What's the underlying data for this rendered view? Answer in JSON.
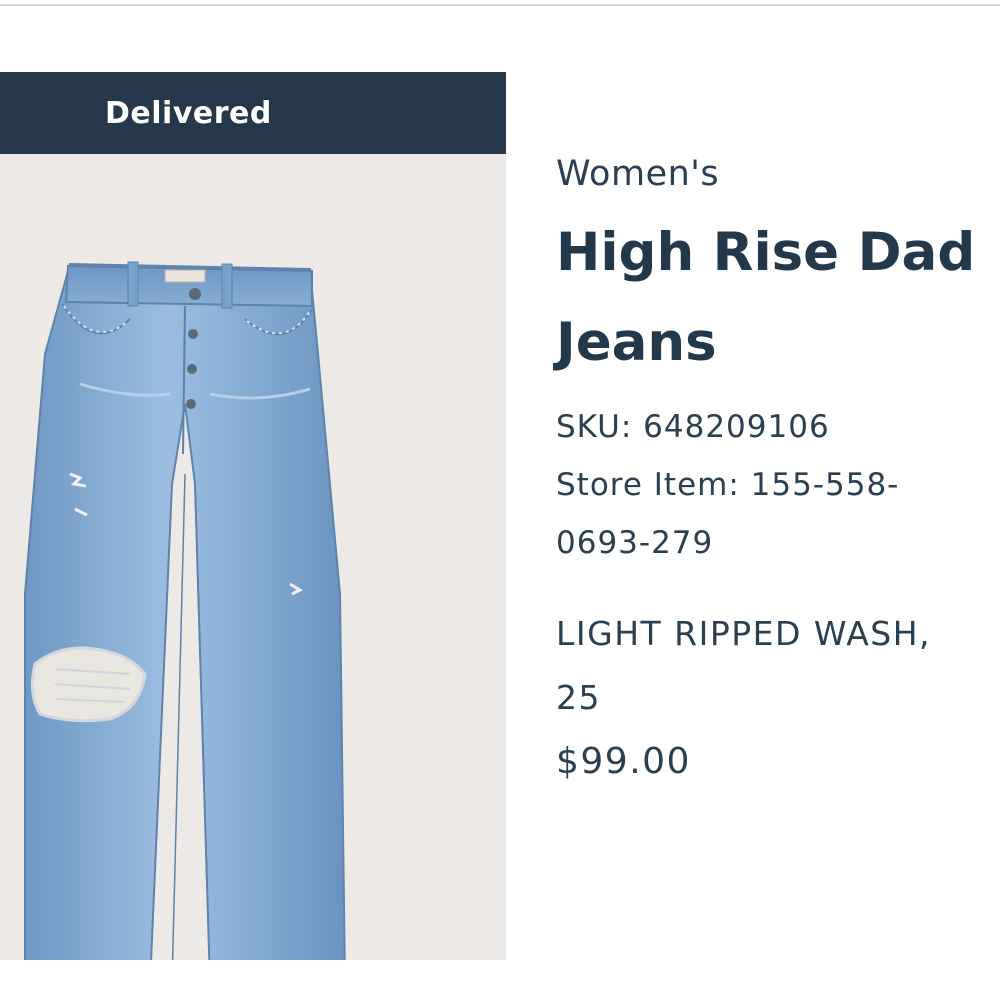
{
  "order_item": {
    "status": "Delivered",
    "image": "light ripped wash high rise dad jeans product photo",
    "category": "Women's",
    "name_line1": "High Rise Dad",
    "name_line2": "Jeans",
    "sku": "SKU: 648209106",
    "store_item_line1": "Store Item: 155-558-",
    "store_item_line2": "0693-279",
    "variant_line1": "LIGHT RIPPED WASH,",
    "variant_line2": "25",
    "price": "$99.00"
  },
  "colors": {
    "banner": "#25384a",
    "text": "#2a3f52",
    "image_background": "#ece9e6",
    "denim": "#7fa6cf"
  }
}
